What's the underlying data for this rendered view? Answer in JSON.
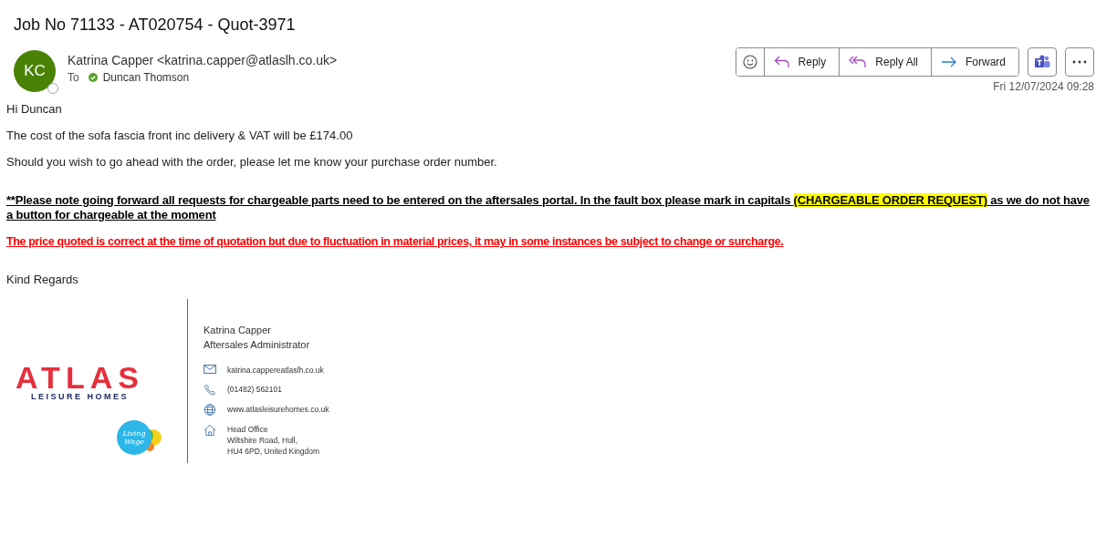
{
  "subject": "Job No 71133 - AT020754 - Quot-3971",
  "sender": {
    "initials": "KC",
    "name": "Katrina Capper <katrina.capper@atlaslh.co.uk>",
    "to_label": "To",
    "recipient": "Duncan Thomson",
    "recipient_verified": true
  },
  "actions": [
    {
      "label": "Reply",
      "kind": "reply"
    },
    {
      "label": "Reply All",
      "kind": "replyall"
    },
    {
      "label": "Forward",
      "kind": "forward"
    }
  ],
  "date": "Fri 12/07/2024 09:28",
  "body": [
    {
      "kind": "plain",
      "segments": [
        {
          "text": "Hi Duncan",
          "highlight": false
        }
      ]
    },
    {
      "kind": "plain",
      "segments": [
        {
          "text": "The cost of the sofa fascia front inc delivery & VAT will be £174.00",
          "highlight": false
        }
      ]
    },
    {
      "kind": "plain",
      "segments": [
        {
          "text": "Should you wish to go ahead with the order, please let me know your purchase order number.",
          "highlight": false
        }
      ]
    },
    {
      "kind": "gap"
    },
    {
      "kind": "notice",
      "segments": [
        {
          "text": "**Please note going forward all requests for chargeable parts need to be entered on the aftersales portal.  In the fault box please mark in capitals ",
          "highlight": false
        },
        {
          "text": "(CHARGEABLE ORDER REQUEST)",
          "highlight": true
        },
        {
          "text": " as we do not have a button for chargeable at the moment",
          "highlight": false
        }
      ]
    },
    {
      "kind": "warning",
      "segments": [
        {
          "text": "The price quoted is correct at the time of quotation but due to fluctuation in material prices, it may in some instances be subject to change or surcharge.",
          "highlight": false
        }
      ]
    },
    {
      "kind": "gap"
    },
    {
      "kind": "plain",
      "segments": [
        {
          "text": "Kind Regards",
          "highlight": false
        }
      ]
    }
  ],
  "signature": {
    "logo_word": "ATLAS",
    "logo_sub": "LEISURE HOMES",
    "badge_lines": [
      "Living",
      "Wage"
    ],
    "name": "Katrina Capper",
    "role": "Aftersales Administrator",
    "contacts": [
      {
        "kind": "email",
        "lines": [
          "katrina.cappereatlaslh.co.uk"
        ]
      },
      {
        "kind": "phone",
        "lines": [
          "(01482) 562101"
        ]
      },
      {
        "kind": "web",
        "lines": [
          "www.atlasleisurehomes.co.uk"
        ]
      },
      {
        "kind": "address",
        "lines": [
          "Head Office",
          "Wiltshire Road, Hull,",
          "HU4 6PD, United Kingdom"
        ]
      }
    ]
  }
}
